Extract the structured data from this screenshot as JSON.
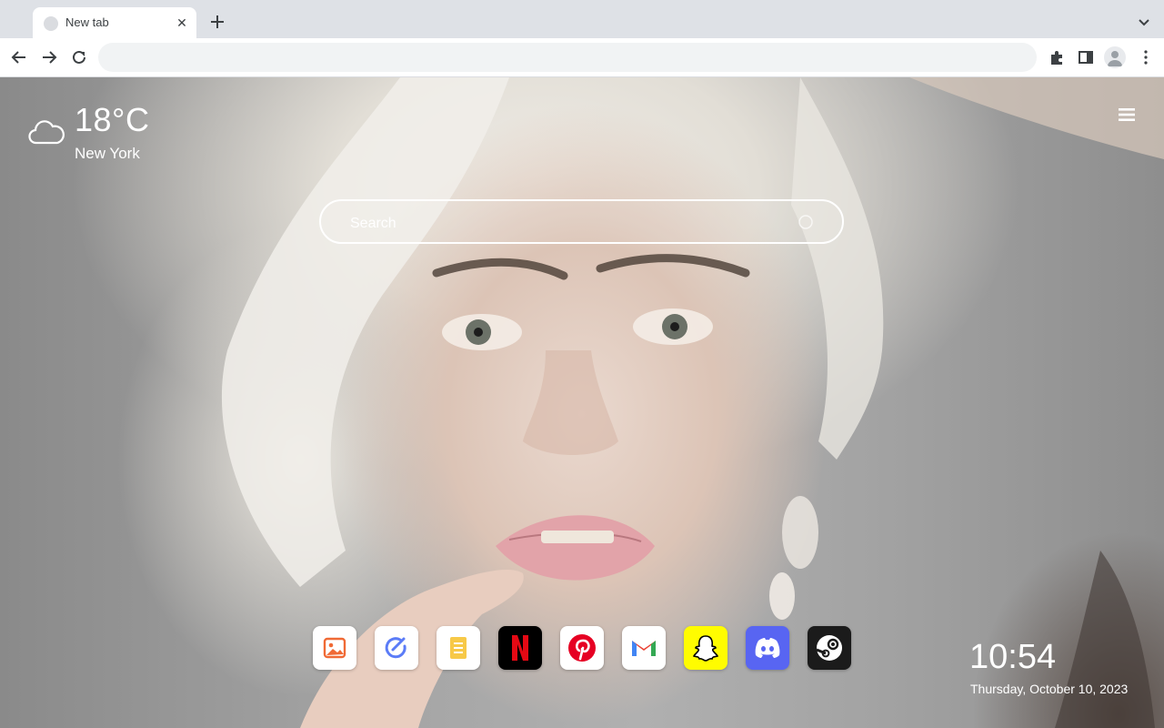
{
  "browser": {
    "tab_title": "New tab",
    "tab_close": "✕",
    "address_value": "",
    "icons": [
      "back-icon",
      "forward-icon",
      "reload-icon",
      "extensions-icon",
      "side-panel-icon",
      "profile-icon",
      "more-icon",
      "new-tab-icon",
      "tab-search-icon"
    ]
  },
  "weather": {
    "temperature": "18°C",
    "city": "New York",
    "icon": "cloud-icon"
  },
  "search": {
    "placeholder": "Search"
  },
  "dock": {
    "apps": [
      "photos-app",
      "tasks-app",
      "notes-app",
      "netflix-app",
      "pinterest-app",
      "gmail-app",
      "snapchat-app",
      "discord-app",
      "steam-app"
    ]
  },
  "clock": {
    "time": "10:54",
    "date": "Thursday, October 10, 2023"
  },
  "colors": {
    "netflix": "#e50914",
    "pinterest": "#e60023",
    "snapchat": "#fffc00",
    "discord": "#5865f2",
    "steam": "#1b1b1b"
  }
}
